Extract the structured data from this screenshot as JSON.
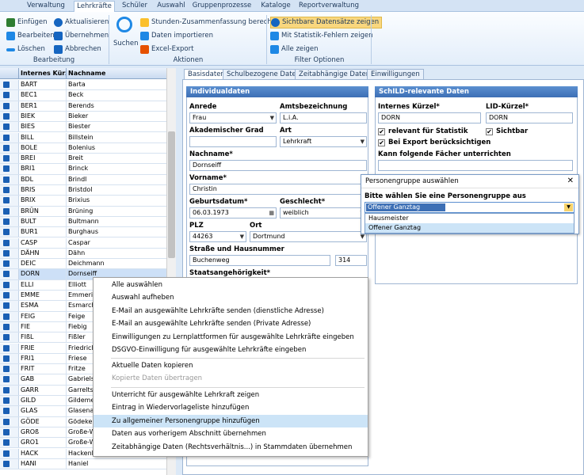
{
  "menubar": {
    "tabs": [
      "Verwaltung",
      "Lehrkräfte",
      "Schüler",
      "Auswahl",
      "Gruppenprozesse",
      "Kataloge",
      "Reportverwaltung"
    ],
    "active": "Lehrkräfte"
  },
  "ribbon": {
    "bearbeitung": {
      "einfuegen": "Einfügen",
      "aktualisieren": "Aktualisieren",
      "bearbeiten": "Bearbeiten",
      "uebernehmen": "Übernehmen",
      "loeschen": "Löschen",
      "abbrechen": "Abbrechen",
      "group_label": "Bearbeitung"
    },
    "aktionen": {
      "suchen": "Suchen",
      "stunden": "Stunden-Zusammenfassung berechnen",
      "import": "Daten importieren",
      "excel": "Excel-Export",
      "group_label": "Aktionen"
    },
    "filter": {
      "sichtbare": "Sichtbare Datensätze zeigen",
      "statistik": "Mit Statistik-Fehlern zeigen",
      "alle": "Alle zeigen",
      "group_label": "Filter Optionen"
    }
  },
  "grid": {
    "col_kuerzel": "Internes Kürz",
    "col_nachname": "Nachname",
    "rows": [
      {
        "k": "BART",
        "n": "Barta"
      },
      {
        "k": "BEC1",
        "n": "Beck"
      },
      {
        "k": "BER1",
        "n": "Berends"
      },
      {
        "k": "BIEK",
        "n": "Bieker"
      },
      {
        "k": "BIES",
        "n": "Biester"
      },
      {
        "k": "BILL",
        "n": "Billstein"
      },
      {
        "k": "BOLE",
        "n": "Bolenius"
      },
      {
        "k": "BREI",
        "n": "Breit"
      },
      {
        "k": "BRI1",
        "n": "Brinck"
      },
      {
        "k": "BDL",
        "n": "Brindl"
      },
      {
        "k": "BRIS",
        "n": "Bristdol"
      },
      {
        "k": "BRIX",
        "n": "Brixius"
      },
      {
        "k": "BRÜN",
        "n": "Brüning"
      },
      {
        "k": "BULT",
        "n": "Bultmann"
      },
      {
        "k": "BUR1",
        "n": "Burghaus"
      },
      {
        "k": "CASP",
        "n": "Caspar"
      },
      {
        "k": "DÄHN",
        "n": "Dähn"
      },
      {
        "k": "DEIC",
        "n": "Deichmann"
      },
      {
        "k": "DORN",
        "n": "Dornseiff"
      },
      {
        "k": "ELLI",
        "n": "Elliott"
      },
      {
        "k": "EMME",
        "n": "Emmerich"
      },
      {
        "k": "ESMA",
        "n": "Esmarch"
      },
      {
        "k": "FEIG",
        "n": "Feige"
      },
      {
        "k": "FIE",
        "n": "Fiebig"
      },
      {
        "k": "FIßL",
        "n": "Fißler"
      },
      {
        "k": "FRIE",
        "n": "Friedrich"
      },
      {
        "k": "FRI1",
        "n": "Friese"
      },
      {
        "k": "FRIT",
        "n": "Fritze"
      },
      {
        "k": "GAB",
        "n": "Gabriels"
      },
      {
        "k": "GARR",
        "n": "Garrelts"
      },
      {
        "k": "GILD",
        "n": "Gildemeister"
      },
      {
        "k": "GLAS",
        "n": "Glasenapp"
      },
      {
        "k": "GÖDE",
        "n": "Gödeke"
      },
      {
        "k": "GROß",
        "n": "Große-Wieners"
      },
      {
        "k": "GRO1",
        "n": "Große-Wilde"
      },
      {
        "k": "HACK",
        "n": "Hackenbroich"
      },
      {
        "k": "HANI",
        "n": "Haniel"
      }
    ]
  },
  "detail": {
    "tabs": [
      "Basisdaten",
      "Schulbezogene Daten",
      "Zeitabhängige Daten",
      "Einwilligungen"
    ],
    "individual": {
      "header": "Individualdaten",
      "anrede_label": "Anrede",
      "anrede_value": "Frau",
      "amtsbez_label": "Amtsbezeichnung",
      "amtsbez_value": "L.i.A.",
      "akad_label": "Akademischer Grad",
      "art_label": "Art",
      "art_value": "Lehrkraft",
      "nachname_label": "Nachname*",
      "nachname_value": "Dornseiff",
      "vorname_label": "Vorname*",
      "vorname_value": "Christin",
      "geburt_label": "Geburtsdatum*",
      "geburt_value": "06.03.1973",
      "geschlecht_label": "Geschlecht*",
      "geschlecht_value": "weiblich",
      "plz_label": "PLZ",
      "plz_value": "44263",
      "ort_label": "Ort",
      "ort_value": "Dortmund",
      "strasse_label": "Straße und Hausnummer",
      "strasse_value": "Buchenweg",
      "hausnr_value": "314",
      "staat_label": "Staatsangehörigkeit*"
    },
    "schild": {
      "header": "SchILD-relevante Daten",
      "kuerzel_label": "Internes Kürzel*",
      "kuerzel_value": "DORN",
      "lid_label": "LID-Kürzel*",
      "lid_value": "DORN",
      "relevant_label": "relevant für Statistik",
      "sichtbar_label": "Sichtbar",
      "export_label": "Bei Export berücksichtigen",
      "faecher_label": "Kann folgende Fächer unterrichten"
    }
  },
  "context_menu": {
    "items": [
      "Alle auswählen",
      "Auswahl aufheben",
      "E-Mail an ausgewählte Lehrkräfte senden (dienstliche Adresse)",
      "E-Mail an ausgewählte Lehrkräfte senden (Private Adresse)",
      "Einwilligungen zu Lernplattformen für ausgewählte Lehrkräfte eingeben",
      "DSGVO-Einwilligung für ausgewählte Lehrkräfte eingeben",
      "Aktuelle Daten kopieren",
      "Kopierte Daten übertragen",
      "Unterricht für ausgewählte Lehrkraft zeigen",
      "Eintrag in Wiedervorlageliste hinzufügen",
      "Zu allgemeiner Personengruppe hinzufügen",
      "Daten aus vorherigem Abschnitt übernehmen",
      "Zeitabhängige Daten (Rechtsverhältnis...) in Stammdaten übernehmen"
    ]
  },
  "popup": {
    "title": "Personengruppe auswählen",
    "close": "✕",
    "prompt": "Bitte wählen Sie eine Personengruppe aus",
    "selected": "Offener Ganztag",
    "options": [
      "Hausmeister",
      "Offener Ganztag"
    ]
  },
  "colors": {
    "accent": "#3d6fb5",
    "highlight": "#cce4f7",
    "ribbon_active": "#f9d77e"
  }
}
